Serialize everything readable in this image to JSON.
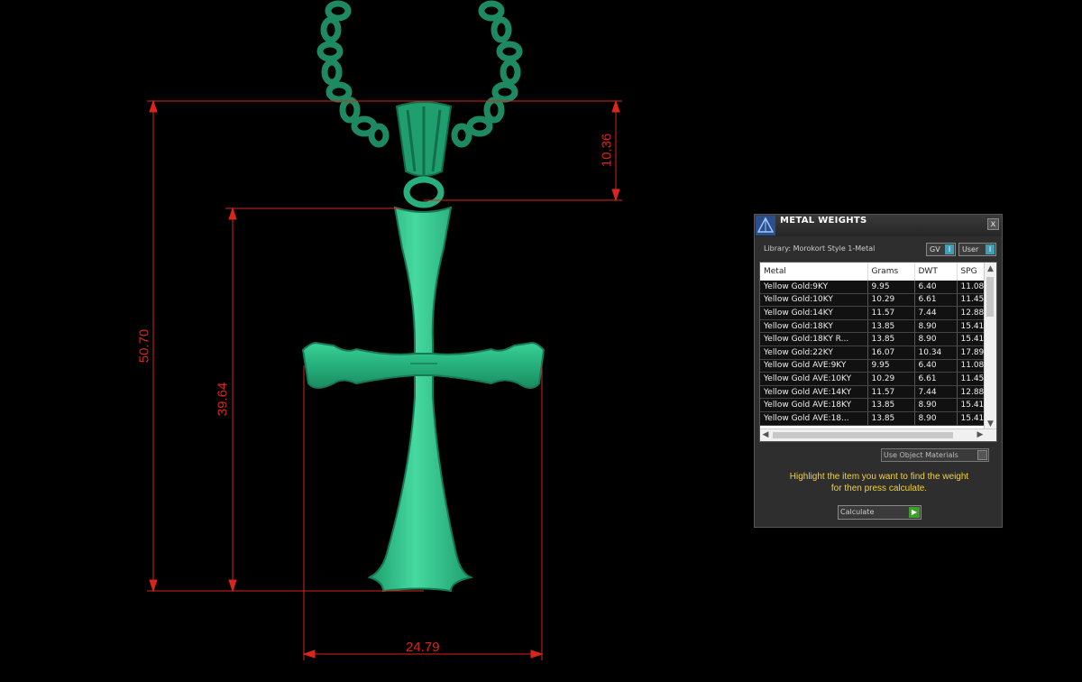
{
  "dimensions": {
    "overall_height": "50.70",
    "bail_height": "10.36",
    "cross_height": "39.64",
    "cross_width": "24.79"
  },
  "panel": {
    "title": "METAL WEIGHTS",
    "close_label": "x",
    "library": "Library: Morokort Style 1-Metal",
    "gv_label": "GV",
    "user_label": "User",
    "toggle_glyph": "I",
    "columns": [
      "Metal",
      "Grams",
      "DWT",
      "SPG"
    ],
    "rows": [
      [
        "Yellow Gold:9KY",
        "9.95",
        "6.40",
        "11.08"
      ],
      [
        "Yellow Gold:10KY",
        "10.29",
        "6.61",
        "11.45"
      ],
      [
        "Yellow Gold:14KY",
        "11.57",
        "7.44",
        "12.88"
      ],
      [
        "Yellow Gold:18KY",
        "13.85",
        "8.90",
        "15.41"
      ],
      [
        "Yellow Gold:18KY R...",
        "13.85",
        "8.90",
        "15.41"
      ],
      [
        "Yellow Gold:22KY",
        "16.07",
        "10.34",
        "17.89"
      ],
      [
        "Yellow Gold AVE:9KY",
        "9.95",
        "6.40",
        "11.08"
      ],
      [
        "Yellow Gold AVE:10KY",
        "10.29",
        "6.61",
        "11.45"
      ],
      [
        "Yellow Gold AVE:14KY",
        "11.57",
        "7.44",
        "12.88"
      ],
      [
        "Yellow Gold AVE:18KY",
        "13.85",
        "8.90",
        "15.41"
      ],
      [
        "Yellow Gold AVE:18...",
        "13.85",
        "8.90",
        "15.41"
      ]
    ],
    "use_object_materials": "Use Object Materials",
    "hint_line1": "Highlight the item you want to find the weight",
    "hint_line2": "for then press calculate.",
    "calculate_label": "Calculate"
  },
  "colors": {
    "pendant": "#2fbf8a",
    "dimension_lines": "#d8261c",
    "hint_text": "#f4d235",
    "background": "#000000"
  }
}
